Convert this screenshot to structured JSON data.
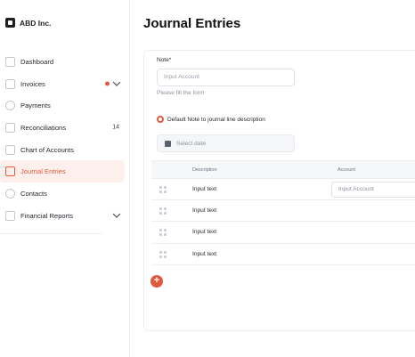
{
  "brand": {
    "name": "ABD Inc."
  },
  "sidebar": {
    "items": [
      {
        "label": "Dashboard"
      },
      {
        "label": "Invoices"
      },
      {
        "label": "Payments"
      },
      {
        "label": "Reconciliations",
        "count": "14"
      },
      {
        "label": "Chart of Accounts"
      },
      {
        "label": "Journal Entries"
      },
      {
        "label": "Contacts"
      },
      {
        "label": "Financial Reports"
      }
    ]
  },
  "page": {
    "title": "Journal Entries"
  },
  "form": {
    "note_label": "Note*",
    "note_placeholder": "Input Account",
    "hint": "Please fill the form",
    "default_note_label": "Default Note to journal line description",
    "date_placeholder": "Select date"
  },
  "table": {
    "columns": [
      "Description",
      "Account"
    ],
    "rows": [
      {
        "description": "Input text",
        "account_placeholder": "Input Account"
      },
      {
        "description": "Input text"
      },
      {
        "description": "Input text"
      },
      {
        "description": "Input text"
      }
    ]
  },
  "add_button": {
    "label": "+"
  },
  "colors": {
    "accent": "#e05a3f",
    "active_bg": "#fdf0ec"
  }
}
